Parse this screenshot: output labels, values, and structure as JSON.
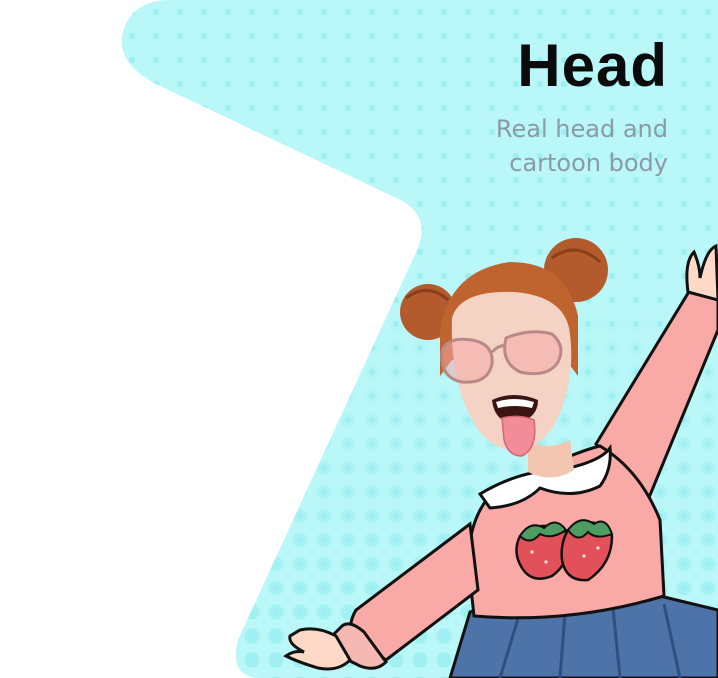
{
  "feature_card": {
    "title": "Head",
    "subtitle": "Real head and cartoon body",
    "colors": {
      "card_background": "#b9f7f8",
      "dot_pattern": "#9eeff1",
      "title": "#0b0b0b",
      "subtitle": "#8a9aa6"
    },
    "illustration": {
      "description_icon": "head-swap-illustration"
    }
  }
}
